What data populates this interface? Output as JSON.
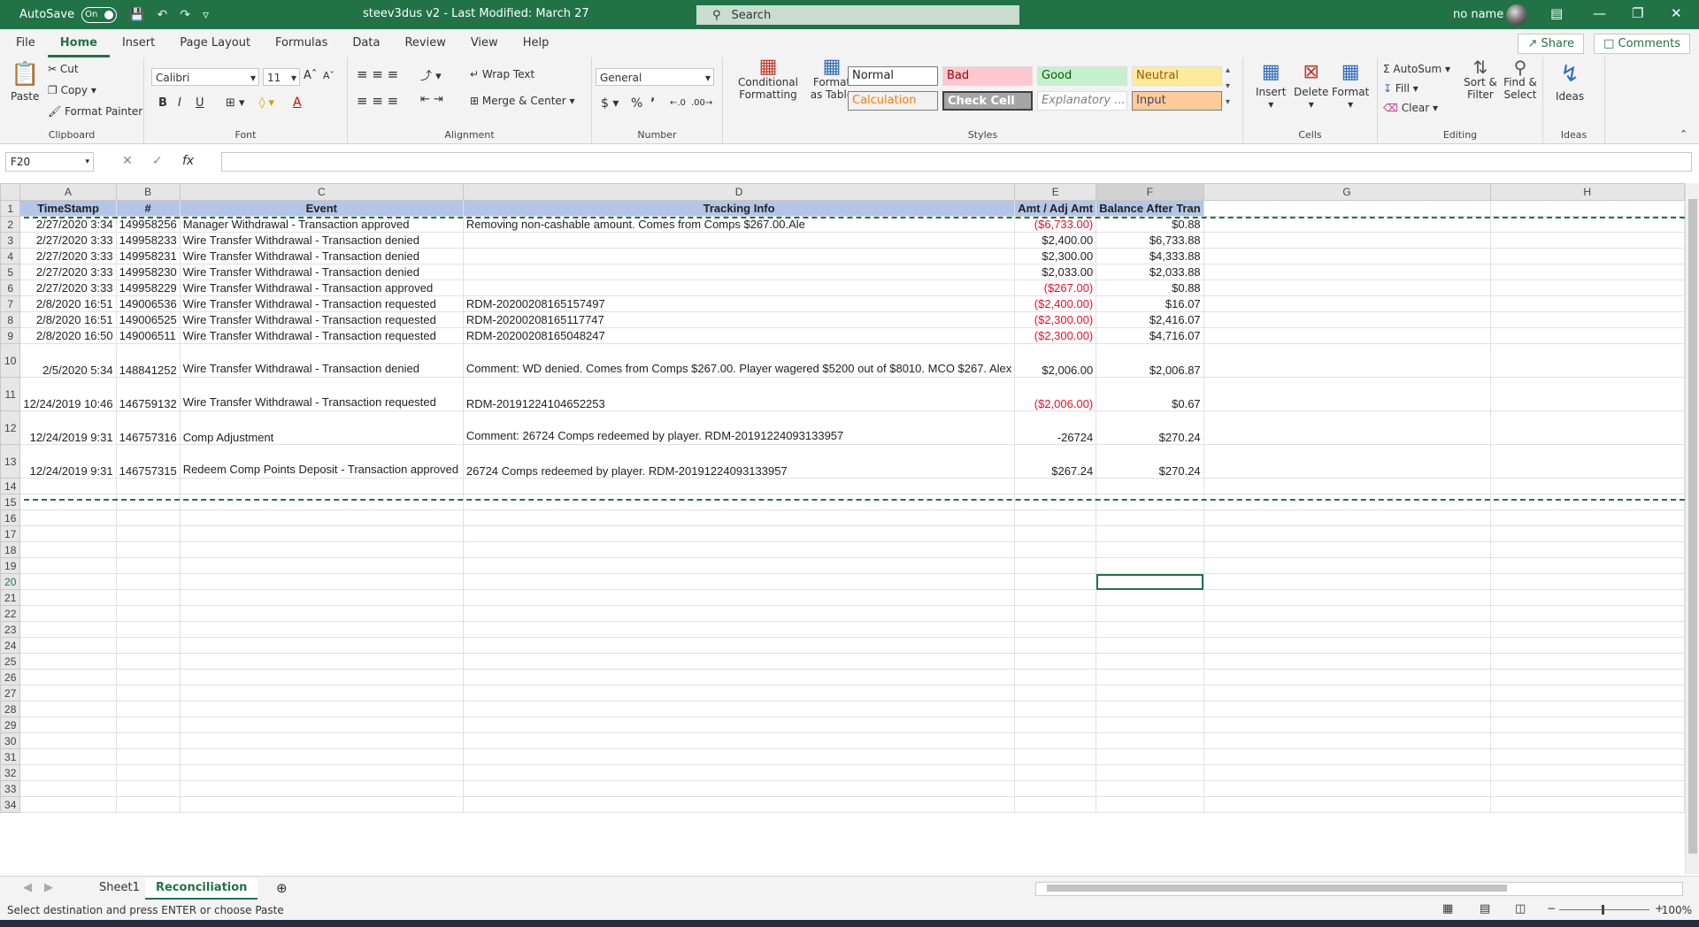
{
  "titlebar": {
    "autosave_label": "AutoSave",
    "toggle_state": "On",
    "doc_title": "steev3dus v2  -  Last Modified: March 27",
    "search_placeholder": "Search",
    "user_name": "no name"
  },
  "ribbon_tabs": [
    "File",
    "Home",
    "Insert",
    "Page Layout",
    "Formulas",
    "Data",
    "Review",
    "View",
    "Help"
  ],
  "share_label": "Share",
  "comments_label": "Comments",
  "ribbon": {
    "clipboard": {
      "paste": "Paste",
      "cut": "Cut",
      "copy": "Copy",
      "format_painter": "Format Painter",
      "label": "Clipboard"
    },
    "font": {
      "font_name": "Calibri",
      "font_size": "11",
      "label": "Font"
    },
    "alignment": {
      "wrap_text": "Wrap Text",
      "merge_center": "Merge & Center",
      "label": "Alignment"
    },
    "number": {
      "format": "General",
      "label": "Number"
    },
    "styles": {
      "conditional_formatting": "Conditional Formatting",
      "format_as_table": "Format as Table",
      "normal": "Normal",
      "bad": "Bad",
      "good": "Good",
      "neutral": "Neutral",
      "calculation": "Calculation",
      "check_cell": "Check Cell",
      "explanatory": "Explanatory ...",
      "input": "Input",
      "label": "Styles"
    },
    "cells": {
      "insert": "Insert",
      "delete": "Delete",
      "format": "Format",
      "label": "Cells"
    },
    "editing": {
      "autosum": "AutoSum",
      "fill": "Fill",
      "clear": "Clear",
      "sort_filter": "Sort & Filter",
      "find_select": "Find & Select",
      "label": "Editing"
    },
    "ideas": {
      "ideas": "Ideas",
      "label": "Ideas"
    }
  },
  "formula_bar": {
    "name_box": "F20",
    "fx": "fx",
    "formula": ""
  },
  "columns": [
    "A",
    "B",
    "C",
    "D",
    "E",
    "F",
    "G",
    "H"
  ],
  "header_row": [
    "TimeStamp",
    "#",
    "Event",
    "Tracking Info",
    "Amt / Adj Amt",
    "Balance After Tran"
  ],
  "rows": [
    {
      "ts": "2/27/2020 3:34",
      "id": "149958256",
      "event": "Manager Withdrawal - Transaction approved",
      "info": "Removing non-cashable amount. Comes from Comps $267.00.Ale",
      "amt": "($6,733.00)",
      "neg": true,
      "bal": "$0.88"
    },
    {
      "ts": "2/27/2020 3:33",
      "id": "149958233",
      "event": "Wire Transfer Withdrawal - Transaction denied",
      "info": "",
      "amt": "$2,400.00",
      "neg": false,
      "bal": "$6,733.88"
    },
    {
      "ts": "2/27/2020 3:33",
      "id": "149958231",
      "event": "Wire Transfer Withdrawal - Transaction denied",
      "info": "",
      "amt": "$2,300.00",
      "neg": false,
      "bal": "$4,333.88"
    },
    {
      "ts": "2/27/2020 3:33",
      "id": "149958230",
      "event": "Wire Transfer Withdrawal - Transaction denied",
      "info": "",
      "amt": "$2,033.00",
      "neg": false,
      "bal": "$2,033.88"
    },
    {
      "ts": "2/27/2020 3:33",
      "id": "149958229",
      "event": "Wire Transfer Withdrawal - Transaction approved",
      "info": "",
      "amt": "($267.00)",
      "neg": true,
      "bal": "$0.88"
    },
    {
      "ts": "2/8/2020 16:51",
      "id": "149006536",
      "event": "Wire Transfer Withdrawal - Transaction requested",
      "info": "RDM-20200208165157497",
      "amt": "($2,400.00)",
      "neg": true,
      "bal": "$16.07"
    },
    {
      "ts": "2/8/2020 16:51",
      "id": "149006525",
      "event": "Wire Transfer Withdrawal - Transaction requested",
      "info": "RDM-20200208165117747",
      "amt": "($2,300.00)",
      "neg": true,
      "bal": "$2,416.07"
    },
    {
      "ts": "2/8/2020 16:50",
      "id": "149006511",
      "event": "Wire Transfer Withdrawal - Transaction requested",
      "info": "RDM-20200208165048247",
      "amt": "($2,300.00)",
      "neg": true,
      "bal": "$4,716.07"
    },
    {
      "ts": "2/5/2020 5:34",
      "id": "148841252",
      "event": "Wire Transfer Withdrawal - Transaction denied",
      "info": "Comment: WD denied. Comes from Comps $267.00. Player wagered $5200 out of $8010. MCO $267. Alex",
      "amt": "$2,006.00",
      "neg": false,
      "bal": "$2,006.87"
    },
    {
      "ts": "12/24/2019 10:46",
      "id": "146759132",
      "event": "Wire Transfer Withdrawal - Transaction requested",
      "info": "RDM-20191224104652253",
      "amt": "($2,006.00)",
      "neg": true,
      "bal": "$0.67"
    },
    {
      "ts": "12/24/2019 9:31",
      "id": "146757316",
      "event": "Comp Adjustment",
      "info": "Comment: 26724 Comps redeemed by player. RDM-20191224093133957",
      "amt": "-26724",
      "neg": false,
      "bal": "$270.24"
    },
    {
      "ts": "12/24/2019 9:31",
      "id": "146757315",
      "event": "Redeem Comp Points Deposit - Transaction approved",
      "info": "26724 Comps redeemed by player. RDM-20191224093133957",
      "amt": "$267.24",
      "neg": false,
      "bal": "$270.24"
    }
  ],
  "empty_row_numbers": [
    "14",
    "15",
    "16",
    "17",
    "18",
    "19",
    "20",
    "21",
    "22",
    "23",
    "24",
    "25",
    "26",
    "27",
    "28",
    "29",
    "30",
    "31",
    "32",
    "33",
    "34"
  ],
  "sheet_tabs": [
    "Sheet1",
    "Reconciliation"
  ],
  "active_sheet": "Reconciliation",
  "status": {
    "message": "Select destination and press ENTER or choose Paste",
    "zoom": "100%"
  }
}
